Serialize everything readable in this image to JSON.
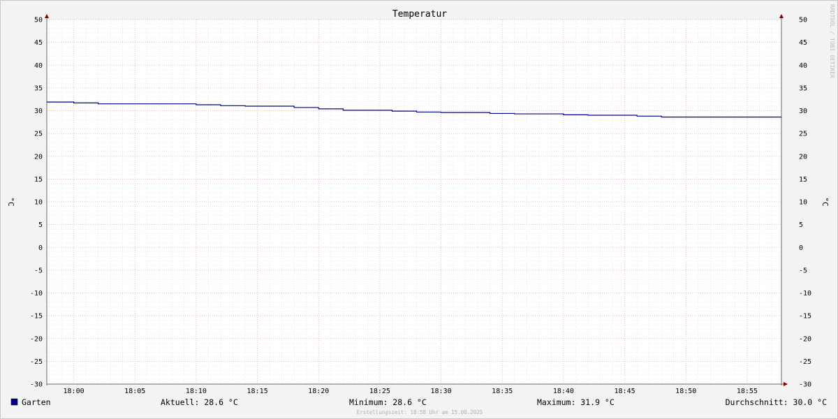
{
  "chart_data": {
    "type": "line",
    "title": "Temperatur",
    "ylabel": "°C",
    "ylabel_right": "°C",
    "ylim": [
      -30,
      50
    ],
    "y_ticks": [
      "50",
      "45",
      "40",
      "35",
      "30",
      "25",
      "20",
      "15",
      "10",
      "5",
      "0",
      "-5",
      "-10",
      "-15",
      "-20",
      "-25",
      "-30"
    ],
    "x_tick_labels": [
      "18:00",
      "18:05",
      "18:10",
      "18:15",
      "18:20",
      "18:25",
      "18:30",
      "18:35",
      "18:40",
      "18:45",
      "18:50",
      "18:55"
    ],
    "x_range_minutes": [
      -2.2,
      57.8
    ],
    "grid": true,
    "series": [
      {
        "name": "Garten",
        "color": "#00008b",
        "points": [
          [
            -2.2,
            31.9
          ],
          [
            0.0,
            31.7
          ],
          [
            2.0,
            31.5
          ],
          [
            10.0,
            31.3
          ],
          [
            12.0,
            31.1
          ],
          [
            14.0,
            31.0
          ],
          [
            18.0,
            30.7
          ],
          [
            20.0,
            30.4
          ],
          [
            22.0,
            30.1
          ],
          [
            26.0,
            29.9
          ],
          [
            28.0,
            29.7
          ],
          [
            30.0,
            29.6
          ],
          [
            34.0,
            29.4
          ],
          [
            36.0,
            29.3
          ],
          [
            40.0,
            29.1
          ],
          [
            42.0,
            29.0
          ],
          [
            46.0,
            28.8
          ],
          [
            48.0,
            28.6
          ],
          [
            57.8,
            28.6
          ]
        ]
      }
    ]
  },
  "watermark": "RRDTOOL / TOBI OETIKER",
  "legend": {
    "series_name": "Garten",
    "swatch_color": "#00008b"
  },
  "stats": {
    "current": "Aktuell: 28.6 °C",
    "minimum": "Minimum: 28.6 °C",
    "maximum": "Maximum: 31.9 °C",
    "average": "Durchschnitt: 30.0 °C"
  },
  "created": "Erstellungszeit: 18:58 Uhr am 15.08.2025"
}
